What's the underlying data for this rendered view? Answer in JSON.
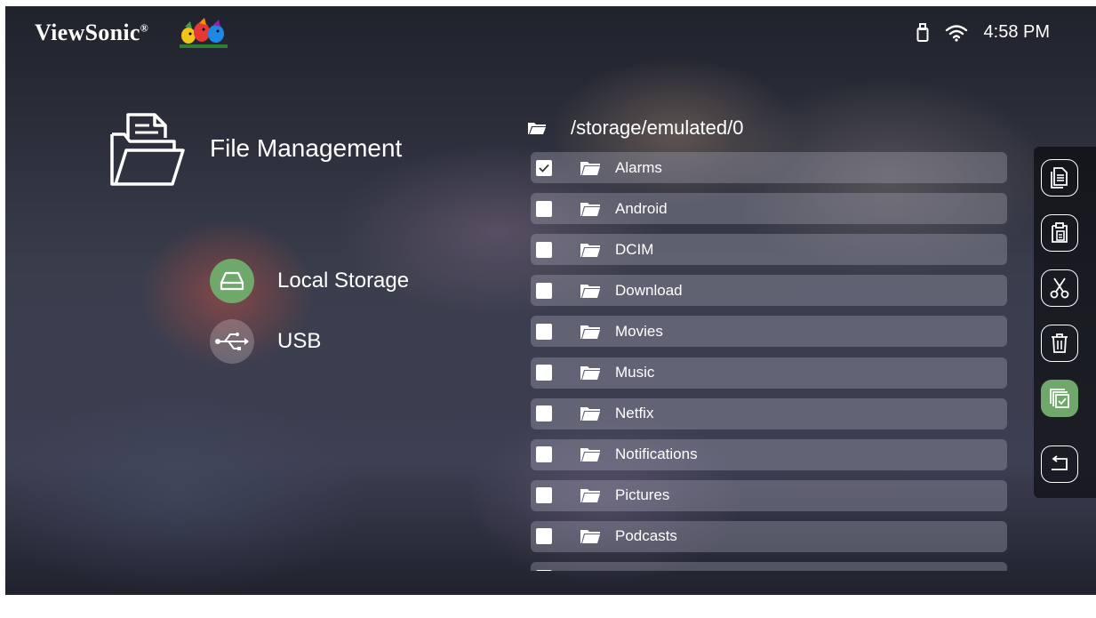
{
  "brand": {
    "name": "ViewSonic",
    "mark": "®"
  },
  "status_bar": {
    "time": "4:58 PM",
    "icons": [
      "usb-drive-icon",
      "wifi-icon"
    ]
  },
  "section": {
    "title": "File Management",
    "icon": "file-folder-icon"
  },
  "sources": [
    {
      "label": "Local Storage",
      "icon": "hard-drive-icon",
      "selected": true
    },
    {
      "label": "USB",
      "icon": "usb-icon",
      "selected": false
    }
  ],
  "path": "/storage/emulated/0",
  "files": [
    {
      "name": "Alarms",
      "checked": true
    },
    {
      "name": "Android",
      "checked": false
    },
    {
      "name": "DCIM",
      "checked": false
    },
    {
      "name": "Download",
      "checked": false
    },
    {
      "name": "Movies",
      "checked": false
    },
    {
      "name": "Music",
      "checked": false
    },
    {
      "name": "Netfix",
      "checked": false
    },
    {
      "name": "Notifications",
      "checked": false
    },
    {
      "name": "Pictures",
      "checked": false
    },
    {
      "name": "Podcasts",
      "checked": false
    },
    {
      "name": "",
      "checked": false
    }
  ],
  "toolbar": [
    {
      "icon": "copy-icon",
      "active": false
    },
    {
      "icon": "paste-icon",
      "active": false
    },
    {
      "icon": "cut-icon",
      "active": false
    },
    {
      "icon": "delete-icon",
      "active": false
    },
    {
      "icon": "select-all-icon",
      "active": true
    },
    {
      "icon": "back-icon",
      "active": false
    }
  ],
  "colors": {
    "accent": "#6fa86a",
    "row_bg": "rgba(170,170,185,0.35)"
  }
}
